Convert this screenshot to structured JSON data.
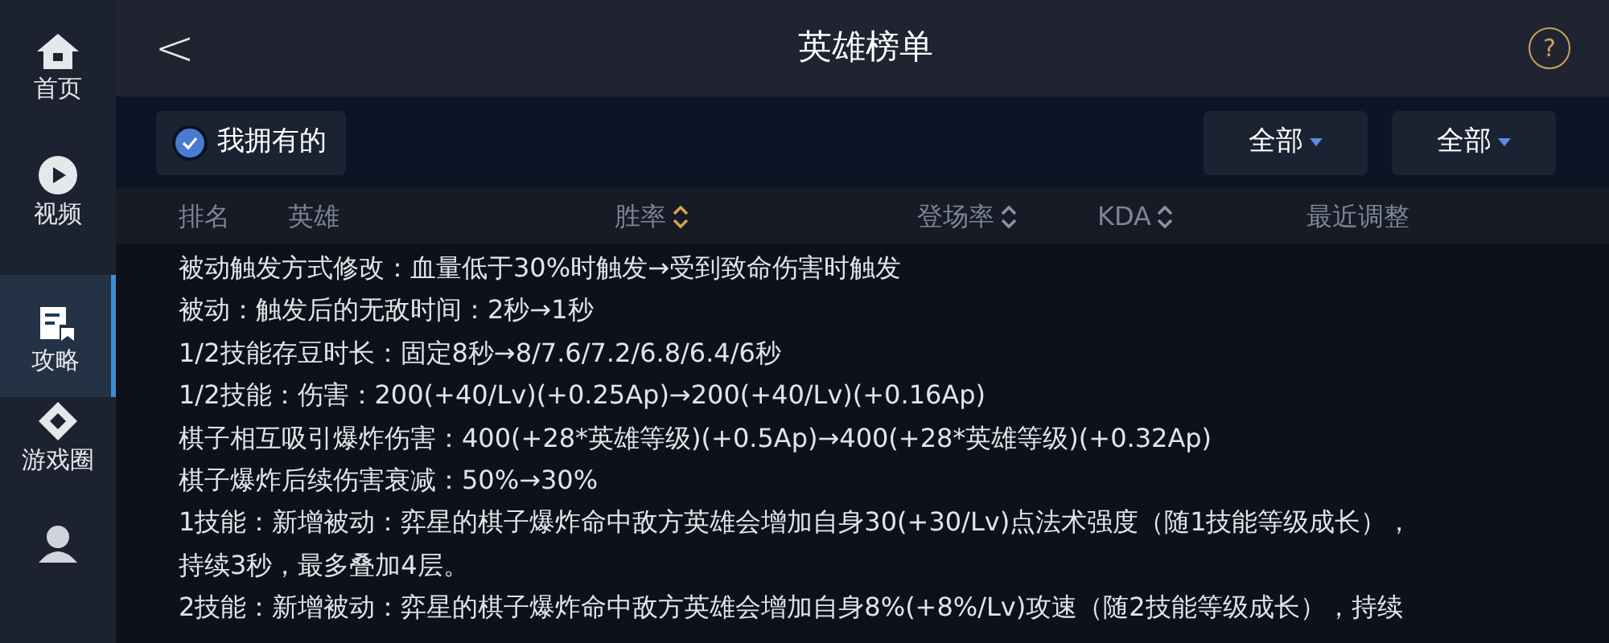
{
  "sidebar": {
    "items": [
      {
        "label": "首页",
        "kind": "home",
        "selected": false
      },
      {
        "label": "视频",
        "kind": "video",
        "selected": false
      },
      {
        "label": "攻略",
        "kind": "guide",
        "selected": true
      },
      {
        "label": "游戏圈",
        "kind": "circle",
        "selected": false
      },
      {
        "kind": "profile",
        "selected": false
      }
    ]
  },
  "header": {
    "back": "<",
    "title": "英雄榜单",
    "help": "?"
  },
  "filters": {
    "owned": {
      "label": "我拥有的",
      "checked": true
    },
    "dropdowns": [
      "全部",
      "全部"
    ]
  },
  "table": {
    "columns": [
      {
        "label": "排名"
      },
      {
        "label": "英雄"
      },
      {
        "label": "胜率",
        "sorted": true
      },
      {
        "label": "登场率",
        "sorted": false
      },
      {
        "label": "KDA",
        "sorted": false
      },
      {
        "label": "最近调整"
      }
    ]
  },
  "notes": [
    "被动触发方式修改：血量低于30%时触发→受到致命伤害时触发",
    "被动：触发后的无敌时间：2秒→1秒",
    "1/2技能存豆时长：固定8秒→8/7.6/7.2/6.8/6.4/6秒",
    "1/2技能：伤害：200(+40/Lv)(+0.25Ap)→200(+40/Lv)(+0.16Ap)",
    "棋子相互吸引爆炸伤害：400(+28*英雄等级)(+0.5Ap)→400(+28*英雄等级)(+0.32Ap)",
    "棋子爆炸后续伤害衰减：50%→30%",
    "1技能：新增被动：弈星的棋子爆炸命中敌方英雄会增加自身30(+30/Lv)点法术强度（随1技能等级成长），",
    "持续3秒，最多叠加4层。",
    "2技能：新增被动：弈星的棋子爆炸命中敌方英雄会增加自身8%(+8%/Lv)攻速（随2技能等级成长），持续"
  ]
}
